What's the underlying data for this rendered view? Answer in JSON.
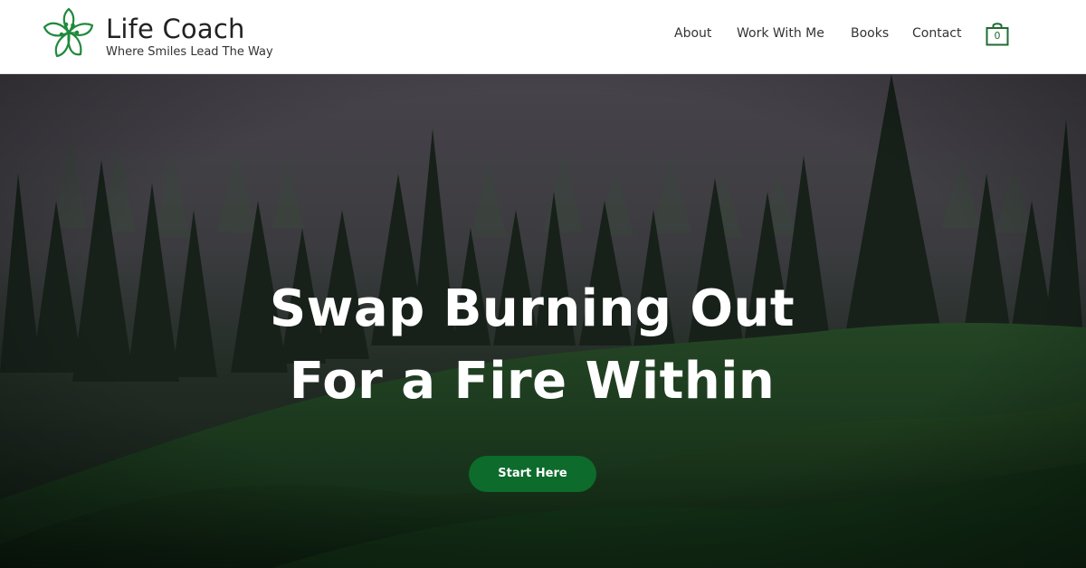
{
  "brand": {
    "title": "Life Coach",
    "tagline": "Where Smiles Lead The Way",
    "logo_icon": "flower-icon",
    "accent_color": "#1f8a3c"
  },
  "nav": {
    "items": [
      {
        "label": "About"
      },
      {
        "label": "Work With Me"
      },
      {
        "label": "Books"
      },
      {
        "label": "Contact"
      }
    ],
    "cart": {
      "icon": "shopping-bag-icon",
      "count": "0"
    }
  },
  "hero": {
    "headline_line1": "Swap Burning Out",
    "headline_line2": "For a Fire Within",
    "cta_label": "Start Here",
    "cta_color": "#0d6b2c",
    "background": "misty pine forest over green hills"
  }
}
